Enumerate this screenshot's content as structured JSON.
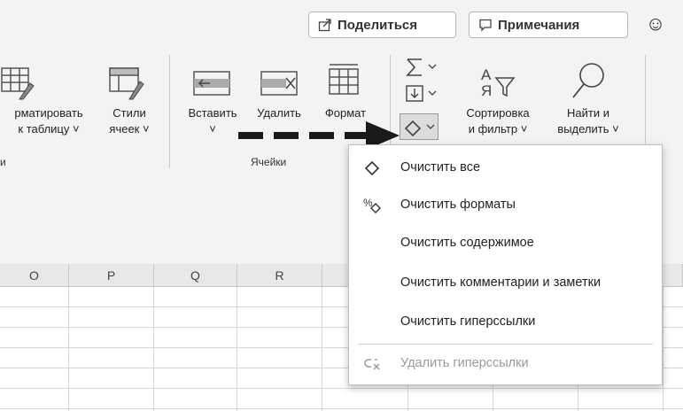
{
  "topbar": {
    "share_label": "Поделиться",
    "comments_label": "Примечания",
    "smiley_icon": "smiley-icon"
  },
  "ribbon": {
    "format_table_line1": "рматировать",
    "format_table_line2": "к таблицу",
    "cell_styles_line1": "Стили",
    "cell_styles_line2": "ячеек",
    "insert_label": "Вставить",
    "delete_label": "Удалить",
    "format_label": "Формат",
    "cells_group_label": "Ячейки",
    "sort_filter_line1": "Сортировка",
    "sort_filter_line2": "и фильтр",
    "find_select_line1": "Найти и",
    "find_select_line2": "выделить",
    "chevron": "˅",
    "left_group_fragment": "и"
  },
  "columns": [
    "O",
    "P",
    "Q",
    "R"
  ],
  "clear_menu": {
    "items": [
      {
        "label": "Очистить все",
        "icon": "eraser-icon",
        "disabled": false
      },
      {
        "label": "Очистить форматы",
        "icon": "percent-eraser-icon",
        "disabled": false
      },
      {
        "label": "Очистить содержимое",
        "icon": "",
        "disabled": false
      },
      {
        "label": "Очистить комментарии и заметки",
        "icon": "",
        "disabled": false
      },
      {
        "label": "Очистить гиперссылки",
        "icon": "",
        "disabled": false
      },
      {
        "label": "Удалить гиперссылки",
        "icon": "unlink-icon",
        "disabled": true
      }
    ]
  }
}
